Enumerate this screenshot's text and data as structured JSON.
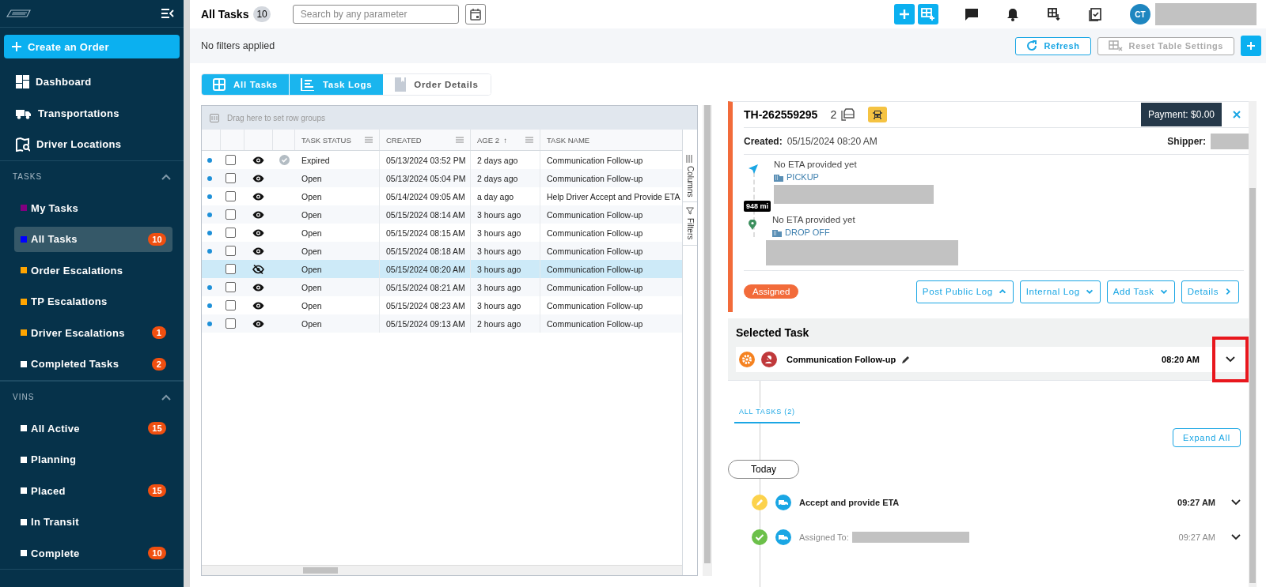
{
  "sidebar": {
    "create_button": "Create an Order",
    "nav": [
      {
        "label": "Dashboard"
      },
      {
        "label": "Transportations"
      },
      {
        "label": "Driver Locations"
      }
    ],
    "sections": [
      {
        "title": "TASKS",
        "expanded": true,
        "items": [
          {
            "label": "My Tasks",
            "color": "#800080",
            "selected": false
          },
          {
            "label": "All Tasks",
            "color": "#0000ff",
            "selected": true,
            "badge": "10"
          },
          {
            "label": "Order Escalations",
            "color": "#ffa500",
            "selected": false
          },
          {
            "label": "TP Escalations",
            "color": "#ffa500",
            "selected": false
          },
          {
            "label": "Driver Escalations",
            "color": "#ffa500",
            "selected": false,
            "badge": "1"
          },
          {
            "label": "Completed Tasks",
            "color": "#ffffff",
            "selected": false,
            "badge": "2"
          }
        ]
      },
      {
        "title": "VINS",
        "expanded": true,
        "items": [
          {
            "label": "All Active",
            "color": "#ffffff",
            "selected": false,
            "badge": "15"
          },
          {
            "label": "Planning",
            "color": "#ffffff",
            "selected": false
          },
          {
            "label": "Placed",
            "color": "#ffffff",
            "selected": false,
            "badge": "15"
          },
          {
            "label": "In Transit",
            "color": "#ffffff",
            "selected": false
          },
          {
            "label": "Complete",
            "color": "#ffffff",
            "selected": false,
            "badge": "10"
          }
        ]
      }
    ]
  },
  "header": {
    "title": "All Tasks",
    "count": "10",
    "search_placeholder": "Search by any parameter",
    "user_initials": "CT"
  },
  "filter_bar": {
    "text": "No filters applied",
    "refresh": "Refresh",
    "reset": {
      "label": "Reset Table Settings",
      "disabled": true
    }
  },
  "view_tabs": [
    {
      "label": "All Tasks",
      "selected": true
    },
    {
      "label": "Task Logs",
      "selected": true
    },
    {
      "label": "Order Details",
      "selected": false
    }
  ],
  "table": {
    "group_hint": "Drag here to set row groups",
    "columns": [
      "TASK STATUS",
      "CREATED",
      "AGE 2",
      "TASK NAME"
    ],
    "sort_arrow": "↑",
    "side_tabs": [
      "Columns",
      "Filters"
    ],
    "rows": [
      {
        "unread": true,
        "hidden": false,
        "selected": false,
        "verified": true,
        "status": "Expired",
        "created": "05/13/2024 03:52 PM",
        "age": "2 days ago",
        "name": "Communication Follow-up"
      },
      {
        "unread": true,
        "hidden": false,
        "selected": false,
        "verified": false,
        "status": "Open",
        "created": "05/13/2024 05:04 PM",
        "age": "2 days ago",
        "name": "Communication Follow-up"
      },
      {
        "unread": true,
        "hidden": false,
        "selected": false,
        "verified": false,
        "status": "Open",
        "created": "05/14/2024 09:05 AM",
        "age": "a day ago",
        "name": "Help Driver Accept and Provide ETA"
      },
      {
        "unread": true,
        "hidden": false,
        "selected": false,
        "verified": false,
        "status": "Open",
        "created": "05/15/2024 08:14 AM",
        "age": "3 hours ago",
        "name": "Communication Follow-up"
      },
      {
        "unread": true,
        "hidden": false,
        "selected": false,
        "verified": false,
        "status": "Open",
        "created": "05/15/2024 08:15 AM",
        "age": "3 hours ago",
        "name": "Communication Follow-up"
      },
      {
        "unread": true,
        "hidden": false,
        "selected": false,
        "verified": false,
        "status": "Open",
        "created": "05/15/2024 08:18 AM",
        "age": "3 hours ago",
        "name": "Communication Follow-up"
      },
      {
        "unread": false,
        "hidden": true,
        "selected": true,
        "verified": false,
        "status": "Open",
        "created": "05/15/2024 08:20 AM",
        "age": "3 hours ago",
        "name": "Communication Follow-up"
      },
      {
        "unread": true,
        "hidden": false,
        "selected": false,
        "verified": false,
        "status": "Open",
        "created": "05/15/2024 08:21 AM",
        "age": "3 hours ago",
        "name": "Communication Follow-up"
      },
      {
        "unread": true,
        "hidden": false,
        "selected": false,
        "verified": false,
        "status": "Open",
        "created": "05/15/2024 08:23 AM",
        "age": "3 hours ago",
        "name": "Communication Follow-up"
      },
      {
        "unread": true,
        "hidden": false,
        "selected": false,
        "verified": false,
        "status": "Open",
        "created": "05/15/2024 09:13 AM",
        "age": "2 hours ago",
        "name": "Communication Follow-up"
      }
    ]
  },
  "order_card": {
    "id": "TH-262559295",
    "vehicles": "2",
    "payment": "Payment: $0.00",
    "created_label": "Created:",
    "created": "05/15/2024 08:20 AM",
    "shipper_label": "Shipper:",
    "distance": "948 mi",
    "stops": [
      {
        "kind": "pickup",
        "eta": "No ETA provided yet",
        "label": "PICKUP"
      },
      {
        "kind": "dropoff",
        "eta": "No ETA provided yet",
        "label": "DROP OFF"
      }
    ],
    "status": "Assigned",
    "actions": [
      "Post Public Log",
      "Internal Log",
      "Add Task",
      "Details"
    ]
  },
  "selected_task": {
    "heading": "Selected Task",
    "name": "Communication Follow-up",
    "time": "08:20 AM",
    "highlighted": true
  },
  "timeline": {
    "tab": "ALL TASKS (2)",
    "expand_all": "Expand All",
    "day": "Today",
    "logs": [
      {
        "kind": "edit",
        "title": "Accept and provide ETA",
        "time": "09:27 AM",
        "bold": true
      },
      {
        "kind": "done",
        "title": "Assigned To:",
        "time": "09:27 AM",
        "bold": false
      }
    ]
  }
}
